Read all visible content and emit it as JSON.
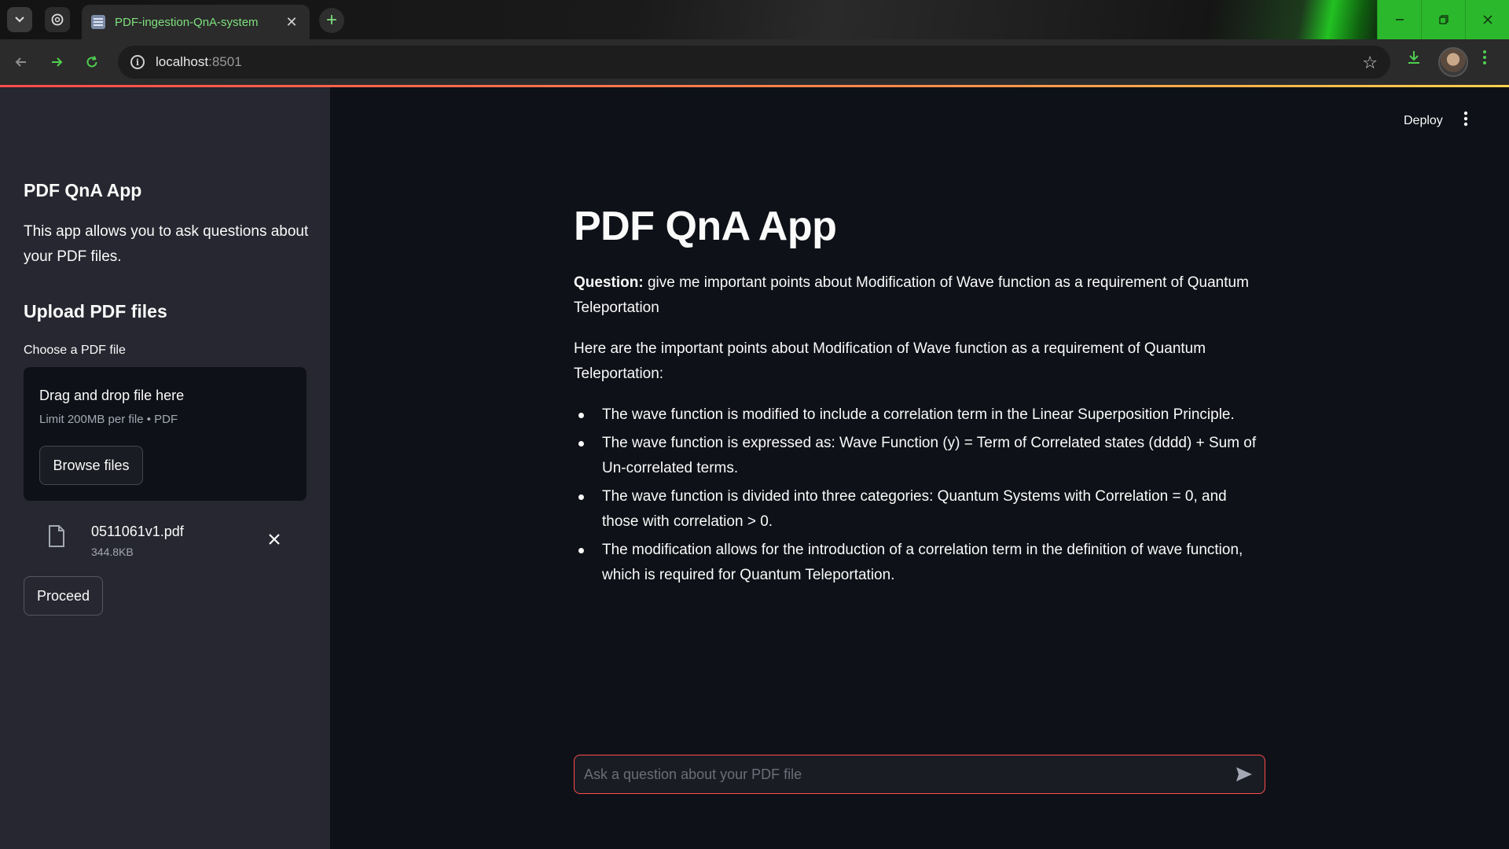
{
  "browser": {
    "tab_title": "PDF-ingestion-QnA-system",
    "tab_close": "✕",
    "new_tab": "+",
    "url_host": "localhost",
    "url_port": ":8501",
    "accent_color": "#4fd04f"
  },
  "sidebar": {
    "title": "PDF QnA App",
    "description": "This app allows you to ask questions about your PDF files.",
    "upload_title": "Upload PDF files",
    "uploader_label": "Choose a PDF file",
    "dropzone_title": "Drag and drop file here",
    "dropzone_limit": "Limit 200MB per file • PDF",
    "browse_label": "Browse files",
    "file": {
      "name": "0511061v1.pdf",
      "size": "344.8KB"
    },
    "proceed_label": "Proceed"
  },
  "header": {
    "deploy_label": "Deploy"
  },
  "main": {
    "title": "PDF QnA App",
    "question_label": "Question:",
    "question_text": "give me important points about Modification of Wave function as a requirement of Quantum Teleportation",
    "answer_intro": "Here are the important points about Modification of Wave function as a requirement of Quantum Teleportation:",
    "points": [
      "The wave function is modified to include a correlation term in the Linear Superposition Principle.",
      "The wave function is expressed as: Wave Function (y) = Term of Correlated states (dddd) + Sum of Un-correlated terms.",
      "The wave function is divided into three categories: Quantum Systems with Correlation = 0, and those with correlation > 0.",
      "The modification allows for the introduction of a correlation term in the definition of wave function, which is required for Quantum Teleportation."
    ],
    "chat_placeholder": "Ask a question about your PDF file",
    "chat_value": ""
  },
  "colors": {
    "sidebar_bg": "#262730",
    "main_bg": "#0e1117",
    "primary": "#ff4b4b"
  }
}
